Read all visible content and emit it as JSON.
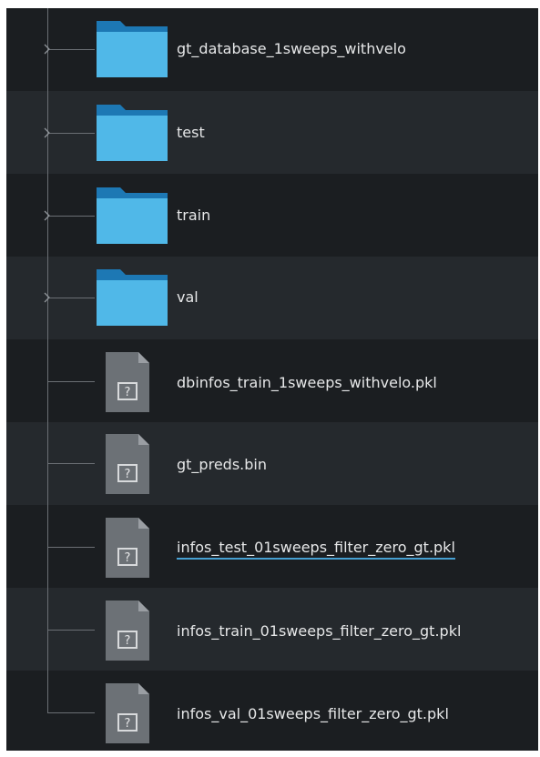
{
  "tree": {
    "items": [
      {
        "label": "gt_database_1sweeps_withvelo",
        "type": "folder",
        "expandable": true
      },
      {
        "label": "test",
        "type": "folder",
        "expandable": true
      },
      {
        "label": "train",
        "type": "folder",
        "expandable": true
      },
      {
        "label": "val",
        "type": "folder",
        "expandable": true
      },
      {
        "label": "dbinfos_train_1sweeps_withvelo.pkl",
        "type": "file",
        "expandable": false
      },
      {
        "label": "gt_preds.bin",
        "type": "file",
        "expandable": false
      },
      {
        "label": "infos_test_01sweeps_filter_zero_gt.pkl",
        "type": "file",
        "expandable": false,
        "selected": true
      },
      {
        "label": "infos_train_01sweeps_filter_zero_gt.pkl",
        "type": "file",
        "expandable": false
      },
      {
        "label": "infos_val_01sweeps_filter_zero_gt.pkl",
        "type": "file",
        "expandable": false
      }
    ],
    "icons": {
      "folder": "folder-icon",
      "file": "unknown-file-icon",
      "expander": "chevron-right-icon"
    },
    "colors": {
      "background": "#1b1e21",
      "alternate_row": "#25292d",
      "text": "#e6e7e8",
      "folder": "#50b8e8",
      "folder_tab": "#1d78b4",
      "file": "#6c7176",
      "selection_underline": "#46a0d2"
    }
  }
}
